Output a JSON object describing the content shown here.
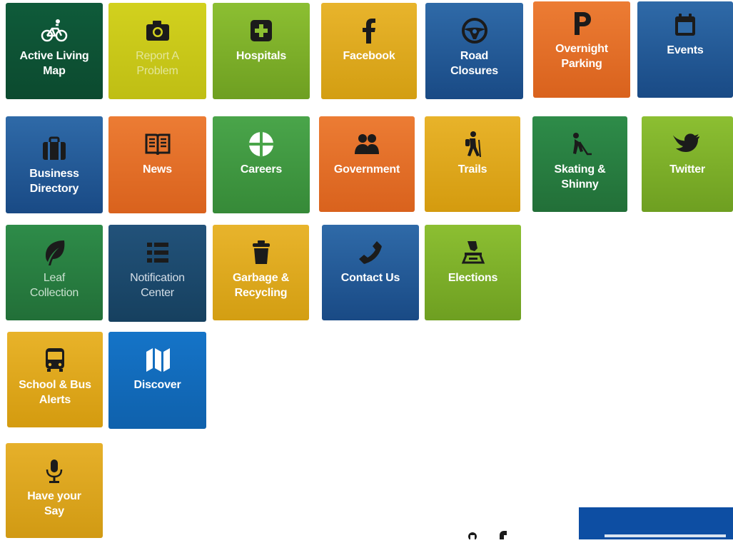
{
  "tiles": [
    {
      "id": "active-living-map",
      "label": "Active Living\nMap",
      "icon": "bicycle-icon",
      "theme": "dkgreen"
    },
    {
      "id": "report-a-problem",
      "label": "Report A\nProblem",
      "icon": "camera-icon",
      "theme": "lime"
    },
    {
      "id": "hospitals",
      "label": "Hospitals",
      "icon": "first-aid-icon",
      "theme": "ltgreen"
    },
    {
      "id": "facebook",
      "label": "Facebook",
      "icon": "facebook-icon",
      "theme": "mustard"
    },
    {
      "id": "road-closures",
      "label": "Road\nClosures",
      "icon": "steering-wheel-icon",
      "theme": "blue"
    },
    {
      "id": "overnight-parking",
      "label": "Overnight\nParking",
      "icon": "parking-icon",
      "theme": "orange"
    },
    {
      "id": "events",
      "label": "Events",
      "icon": "calendar-icon",
      "theme": "blue"
    },
    {
      "id": "business-directory",
      "label": "Business\nDirectory",
      "icon": "briefcase-icon",
      "theme": "blue"
    },
    {
      "id": "news",
      "label": "News",
      "icon": "newspaper-icon",
      "theme": "orange"
    },
    {
      "id": "careers",
      "label": "Careers",
      "icon": "target-icon",
      "theme": "green"
    },
    {
      "id": "government",
      "label": "Government",
      "icon": "people-icon",
      "theme": "orange"
    },
    {
      "id": "trails",
      "label": "Trails",
      "icon": "hiker-icon",
      "theme": "yellow"
    },
    {
      "id": "skating-shinny",
      "label": "Skating &\nShinny",
      "icon": "hockey-player-icon",
      "theme": "leafg"
    },
    {
      "id": "twitter",
      "label": "Twitter",
      "icon": "twitter-bird-icon",
      "theme": "ltgreen"
    },
    {
      "id": "leaf-collection",
      "label": "Leaf\nCollection",
      "icon": "leaf-icon",
      "theme": "leafg"
    },
    {
      "id": "notification-center",
      "label": "Notification\nCenter",
      "icon": "list-icon",
      "theme": "steel"
    },
    {
      "id": "garbage-recycling",
      "label": "Garbage &\nRecycling",
      "icon": "garbage-can-icon",
      "theme": "mustard"
    },
    {
      "id": "contact-us",
      "label": "Contact Us",
      "icon": "phone-icon",
      "theme": "blue"
    },
    {
      "id": "elections",
      "label": "Elections",
      "icon": "ballot-box-icon",
      "theme": "ltgreen"
    },
    {
      "id": "school-bus-alerts",
      "label": "School & Bus\nAlerts",
      "icon": "bus-icon",
      "theme": "yellow"
    },
    {
      "id": "discover",
      "label": "Discover",
      "icon": "map-icon",
      "theme": "royal"
    },
    {
      "id": "have-your-say",
      "label": "Have your\nSay",
      "icon": "microphone-icon",
      "theme": "gold"
    }
  ],
  "colors": {
    "dkgreen": "#0f5b3a",
    "lime": "#d2d11e",
    "ltgreen": "#8cbf32",
    "mustard": "#e8b42c",
    "blue": "#2f6aa8",
    "orange": "#ec7c34",
    "green": "#4aa54a",
    "leafg": "#2e8c49",
    "steel": "#22527a",
    "yellow": "#e8b32a",
    "royal": "#1574c8",
    "gold": "#e6b02a",
    "icon_dark": "#1b1b1b",
    "footer_blue": "#0d4ea3"
  }
}
